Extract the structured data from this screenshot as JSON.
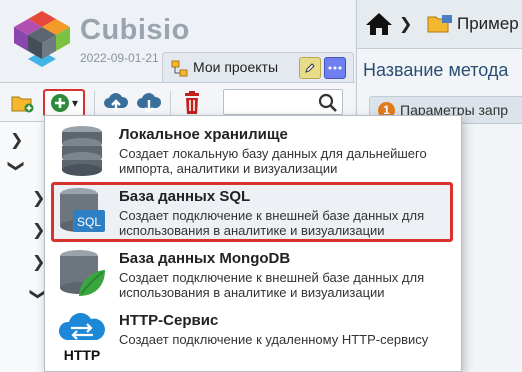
{
  "app": {
    "name": "Cubisio",
    "date": "2022-09-01-21"
  },
  "project_tab": {
    "label": "Мои проекты"
  },
  "breadcrumb": {
    "label": "Пример"
  },
  "main": {
    "title": "Название метода",
    "step_number": "1",
    "step_label": "Параметры запр"
  },
  "toolbar": {
    "add_caret": "▾"
  },
  "search": {
    "placeholder": ""
  },
  "dropdown": {
    "items": [
      {
        "title": "Локальное хранилище",
        "desc": "Создает локальную базу данных для дальнейшего импорта, аналитики и визуализации",
        "icon": "local-storage-icon"
      },
      {
        "title": "База данных SQL",
        "desc": "Создает подключение к внешней базе данных для использования в аналитике и визуализации",
        "icon": "sql-database-icon",
        "icon_text": "SQL"
      },
      {
        "title": "База данных MongoDB",
        "desc": "Создает подключение к внешней базе данных для использования в аналитике и визуализации",
        "icon": "mongodb-icon"
      },
      {
        "title": "HTTP-Сервис",
        "desc": "Создает подключение к удаленному HTTP-сервису",
        "icon": "http-service-icon",
        "icon_text": "HTTP"
      }
    ]
  },
  "colors": {
    "highlight": "#d9312c",
    "accent": "#2b4f73",
    "add_green": "#2e8b3a"
  }
}
